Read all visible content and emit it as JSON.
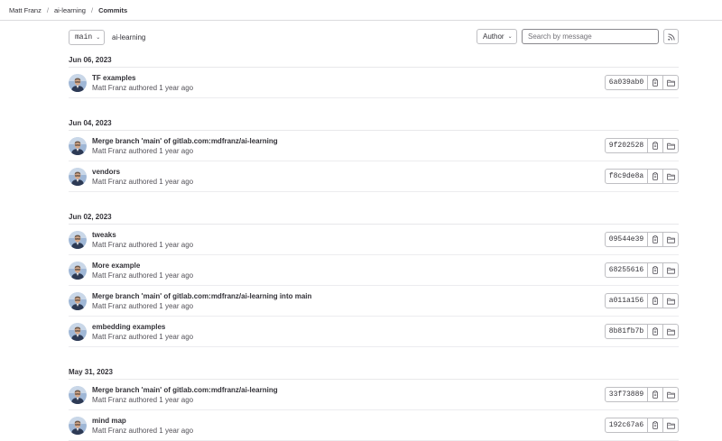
{
  "breadcrumb": {
    "items": [
      "Matt Franz",
      "ai-learning",
      "Commits"
    ],
    "separator": "/"
  },
  "toolbar": {
    "branch": "main",
    "project": "ai-learning",
    "author_label": "Author",
    "search_placeholder": "Search by message",
    "rss_icon": "rss-icon"
  },
  "groups": [
    {
      "date": "Jun 06, 2023",
      "commits": [
        {
          "title": "TF examples",
          "author": "Matt Franz",
          "verb": "authored",
          "time": "1 year ago",
          "sha": "6a039ab0"
        }
      ]
    },
    {
      "date": "Jun 04, 2023",
      "commits": [
        {
          "title": "Merge branch 'main' of gitlab.com:mdfranz/ai-learning",
          "author": "Matt Franz",
          "verb": "authored",
          "time": "1 year ago",
          "sha": "9f202528"
        },
        {
          "title": "vendors",
          "author": "Matt Franz",
          "verb": "authored",
          "time": "1 year ago",
          "sha": "f8c9de8a"
        }
      ]
    },
    {
      "date": "Jun 02, 2023",
      "commits": [
        {
          "title": "tweaks",
          "author": "Matt Franz",
          "verb": "authored",
          "time": "1 year ago",
          "sha": "09544e39"
        },
        {
          "title": "More example",
          "author": "Matt Franz",
          "verb": "authored",
          "time": "1 year ago",
          "sha": "68255616"
        },
        {
          "title": "Merge branch 'main' of gitlab.com:mdfranz/ai-learning into main",
          "author": "Matt Franz",
          "verb": "authored",
          "time": "1 year ago",
          "sha": "a011a156"
        },
        {
          "title": "embedding examples",
          "author": "Matt Franz",
          "verb": "authored",
          "time": "1 year ago",
          "sha": "8b81fb7b"
        }
      ]
    },
    {
      "date": "May 31, 2023",
      "commits": [
        {
          "title": "Merge branch 'main' of gitlab.com:mdfranz/ai-learning",
          "author": "Matt Franz",
          "verb": "authored",
          "time": "1 year ago",
          "sha": "33f73889"
        },
        {
          "title": "mind map",
          "author": "Matt Franz",
          "verb": "authored",
          "time": "1 year ago",
          "sha": "192c67a6"
        }
      ]
    }
  ],
  "icons": {
    "copy": "copy-icon",
    "browse": "folder-icon",
    "dropdown": "chevron-down-icon",
    "avatar": "avatar"
  },
  "colors": {
    "text": "#333238",
    "muted": "#535158",
    "border": "#bfbfc3",
    "divider": "#ececef"
  }
}
